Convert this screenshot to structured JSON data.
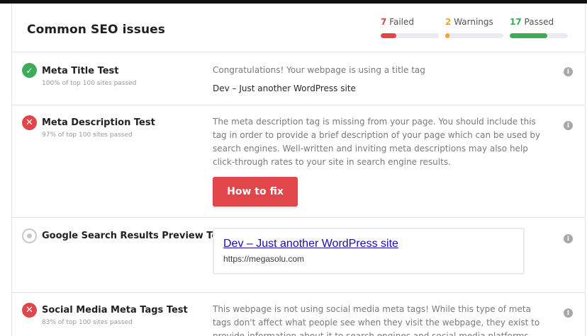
{
  "header": {
    "title": "Common SEO issues",
    "stats": [
      {
        "count": "7",
        "label": "Failed",
        "color": "#e0464a",
        "fill_fraction": 0.27
      },
      {
        "count": "2",
        "label": "Warnings",
        "color": "#f0a72c",
        "fill_fraction": 0.07
      },
      {
        "count": "17",
        "label": "Passed",
        "color": "#3dab5a",
        "fill_fraction": 0.65
      }
    ]
  },
  "tests": [
    {
      "status": "passed",
      "title": "Meta Title Test",
      "subtitle": "100% of top 100 sites passed",
      "description": "Congratulations! Your webpage is using a title tag",
      "value": "Dev – Just another WordPress site"
    },
    {
      "status": "failed",
      "title": "Meta Description Test",
      "subtitle": "97% of top 100 sites passed",
      "description": "The meta description tag is missing from your page. You should include this tag in order to provide a brief description of your page which can be used by search engines. Well-written and inviting meta descriptions may also help click-through rates to your site in search engine results.",
      "button_label": "How to fix"
    },
    {
      "status": "neutral",
      "title": "Google Search Results Preview Test",
      "preview_title": "Dev – Just another WordPress site",
      "preview_url": "https://megasolu.com"
    },
    {
      "status": "failed",
      "title": "Social Media Meta Tags Test",
      "subtitle": "83% of top 100 sites passed",
      "description": "This webpage is not using social media meta tags! While this type of meta tags don't affect what people see when they visit the webpage, they exist to provide information about it to search engines and social media platforms."
    }
  ],
  "icons": {
    "pass": "check-icon",
    "fail": "cross-icon",
    "neutral": "circle-dot-icon",
    "info": "info-icon"
  }
}
